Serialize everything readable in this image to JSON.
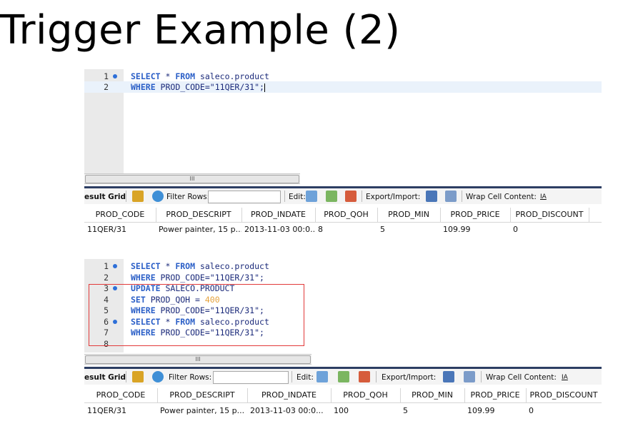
{
  "slide": {
    "title": "Trigger Example (2)"
  },
  "colors": {
    "keyword": "#2b5fc7",
    "string": "#1b2a7a",
    "number": "#e6a23c",
    "gutter": "#eaeaea",
    "breakpoint_dot": "#2d6fd8",
    "highlight_box": "#e23a3a",
    "toolbar_border": "#2d3e63"
  },
  "panel_top": {
    "editor": {
      "lines": [
        {
          "num": "1",
          "dot": true,
          "segs": [
            {
              "k": "kw",
              "t": "SELECT"
            },
            {
              "k": "p",
              "t": " * "
            },
            {
              "k": "kw",
              "t": "FROM"
            },
            {
              "k": "p",
              "t": " saleco.product"
            }
          ]
        },
        {
          "num": "2",
          "dot": false,
          "current": true,
          "caret": true,
          "segs": [
            {
              "k": "kw",
              "t": "WHERE"
            },
            {
              "k": "p",
              "t": " PROD_CODE="
            },
            {
              "k": "s",
              "t": "\"11QER/31\""
            },
            {
              "k": "p",
              "t": ";"
            }
          ]
        }
      ],
      "scroll_thumb": "III"
    },
    "toolbar": {
      "result_grid": "esult Grid",
      "filter_rows": "Filter Rows:",
      "edit": "Edit:",
      "export_import": "Export/Import:",
      "wrap_cell_content": "Wrap Cell Content:",
      "wrap_icon_text": "IA"
    },
    "grid": {
      "columns": [
        "PROD_CODE",
        "PROD_DESCRIPT",
        "PROD_INDATE",
        "PROD_QOH",
        "PROD_MIN",
        "PROD_PRICE",
        "PROD_DISCOUNT"
      ],
      "rows": [
        [
          "11QER/31",
          "Power painter, 15 p...",
          "2013-11-03 00:0...",
          "8",
          "5",
          "109.99",
          "0"
        ]
      ]
    }
  },
  "panel_bottom": {
    "editor": {
      "lines": [
        {
          "num": "1",
          "dot": true,
          "segs": [
            {
              "k": "kw",
              "t": "SELECT"
            },
            {
              "k": "p",
              "t": " * "
            },
            {
              "k": "kw",
              "t": "FROM"
            },
            {
              "k": "p",
              "t": " saleco.product"
            }
          ]
        },
        {
          "num": "2",
          "dot": false,
          "segs": [
            {
              "k": "kw",
              "t": "WHERE"
            },
            {
              "k": "p",
              "t": " PROD_CODE="
            },
            {
              "k": "s",
              "t": "\"11QER/31\""
            },
            {
              "k": "p",
              "t": ";"
            }
          ]
        },
        {
          "num": "3",
          "dot": true,
          "segs": [
            {
              "k": "kw",
              "t": "UPDATE"
            },
            {
              "k": "p",
              "t": " SALECO.PRODUCT"
            }
          ]
        },
        {
          "num": "4",
          "dot": false,
          "segs": [
            {
              "k": "kw",
              "t": "SET"
            },
            {
              "k": "p",
              "t": " PROD_QOH = "
            },
            {
              "k": "n",
              "t": "400"
            }
          ]
        },
        {
          "num": "5",
          "dot": false,
          "segs": [
            {
              "k": "kw",
              "t": "WHERE"
            },
            {
              "k": "p",
              "t": " PROD_CODE="
            },
            {
              "k": "s",
              "t": "\"11QER/31\""
            },
            {
              "k": "p",
              "t": ";"
            }
          ]
        },
        {
          "num": "6",
          "dot": true,
          "segs": [
            {
              "k": "kw",
              "t": "SELECT"
            },
            {
              "k": "p",
              "t": " * "
            },
            {
              "k": "kw",
              "t": "FROM"
            },
            {
              "k": "p",
              "t": " saleco.product"
            }
          ]
        },
        {
          "num": "7",
          "dot": false,
          "segs": [
            {
              "k": "kw",
              "t": "WHERE"
            },
            {
              "k": "p",
              "t": " PROD_CODE="
            },
            {
              "k": "s",
              "t": "\"11QER/31\""
            },
            {
              "k": "p",
              "t": ";"
            }
          ]
        },
        {
          "num": "8",
          "dot": false,
          "segs": []
        }
      ],
      "scroll_thumb": "III"
    },
    "toolbar": {
      "result_grid": "esult Grid",
      "filter_rows": "Filter Rows:",
      "edit": "Edit:",
      "export_import": "Export/Import:",
      "wrap_cell_content": "Wrap Cell Content:",
      "wrap_icon_text": "IA"
    },
    "grid": {
      "columns": [
        "PROD_CODE",
        "PROD_DESCRIPT",
        "PROD_INDATE",
        "PROD_QOH",
        "PROD_MIN",
        "PROD_PRICE",
        "PROD_DISCOUNT"
      ],
      "rows": [
        [
          "11QER/31",
          "Power painter, 15 p...",
          "2013-11-03 00:0...",
          "100",
          "5",
          "109.99",
          "0"
        ]
      ]
    }
  }
}
